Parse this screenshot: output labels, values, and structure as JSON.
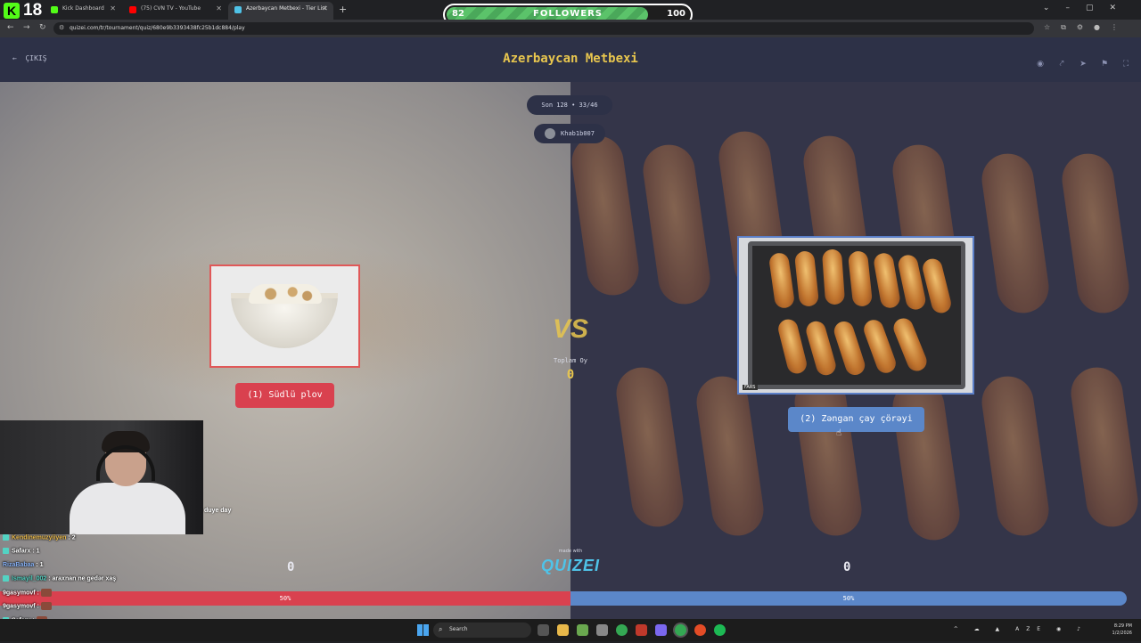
{
  "browser": {
    "tabs": [
      {
        "title": "Kick Dashboard",
        "active": false,
        "icon_color": "#53fc18"
      },
      {
        "title": "(75) CVN TV - YouTube",
        "active": false,
        "icon_color": "#ff0000"
      },
      {
        "title": "Azerbaycan Metbexi - Tier List",
        "active": true,
        "icon_color": "#4fc3e8"
      }
    ],
    "new_tab": "+",
    "url": "quizei.com/tr/tournament/quiz/680e9b3393438fc25b1dc884/play"
  },
  "overlay": {
    "kick_logo": "K",
    "kick_number": "18",
    "followers": {
      "current": "82",
      "label": "FOLLOWERS",
      "goal": "100",
      "progress": 0.82
    }
  },
  "app": {
    "exit_label": "ÇIKIŞ",
    "title": "Azerbaycan Metbexi",
    "header_icons": [
      "eye-icon",
      "share-icon",
      "send-icon",
      "flag-icon",
      "fullscreen-icon"
    ],
    "round_pill": "Son 128 • 33/46",
    "user_pill": "Khab1b007",
    "left": {
      "choice": "(1) Südlü plov",
      "score": "0",
      "percent": "50%",
      "color": "#d9414f"
    },
    "right": {
      "choice": "(2) Zəngan çay çörəyi",
      "score": "0",
      "percent": "50%",
      "color": "#5b87c9",
      "image_tag": "FARS"
    },
    "vs": "VS",
    "total_label": "Toplam Oy",
    "total_value": "0",
    "made_with": "made with",
    "brand": "QUIZEI"
  },
  "stream": {
    "cam_text": "duye day",
    "chat": [
      {
        "user": "Kendinemuzyiiyen",
        "message": ": 2",
        "color": "#e8b84a",
        "badge": true,
        "emote": false
      },
      {
        "user": "Safarx",
        "message": ": 1",
        "color": "#ffffff",
        "badge": true,
        "emote": false
      },
      {
        "user": "RizaBabaa",
        "message": ": 1",
        "color": "#8ab4f8",
        "badge": false,
        "emote": false
      },
      {
        "user": "Ismayil_002",
        "message": ": araxnan ne gedər xaş",
        "color": "#53d3c3",
        "badge": true,
        "emote": false
      },
      {
        "user": "9gasymovf",
        "message": ":",
        "color": "#ffffff",
        "badge": false,
        "emote": true
      },
      {
        "user": "9gasymovf",
        "message": ":",
        "color": "#ffffff",
        "badge": false,
        "emote": true
      },
      {
        "user": "Safarx",
        "message": ":",
        "color": "#ffffff",
        "badge": true,
        "emote": true
      },
      {
        "user": "Safarx",
        "message": ":",
        "color": "#ffffff",
        "badge": true,
        "emote": true
      }
    ]
  },
  "taskbar": {
    "search_placeholder": "Search",
    "language": "AZE",
    "time": "8:29 PM",
    "date": "1/2/2026"
  }
}
